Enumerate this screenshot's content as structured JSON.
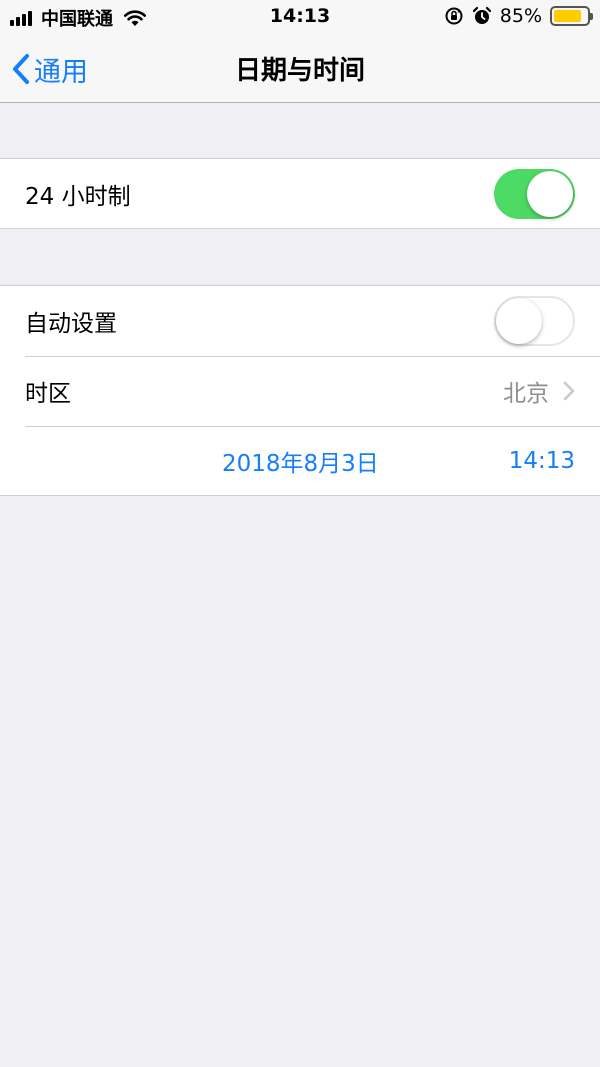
{
  "status_bar": {
    "carrier": "中国联通",
    "time": "14:13",
    "battery": "85%",
    "battery_level": 0.85
  },
  "nav": {
    "back_label": "通用",
    "title": "日期与时间"
  },
  "settings": {
    "hour24": {
      "label": "24 小时制",
      "on": true
    },
    "auto_set": {
      "label": "自动设置",
      "on": false
    },
    "timezone": {
      "label": "时区",
      "value": "北京"
    },
    "date": "2018年8月3日",
    "time": "14:13"
  },
  "colors": {
    "accent": "#157efb",
    "toggle_on": "#4cd964",
    "battery": "#ffcc00",
    "background": "#efeff4"
  }
}
